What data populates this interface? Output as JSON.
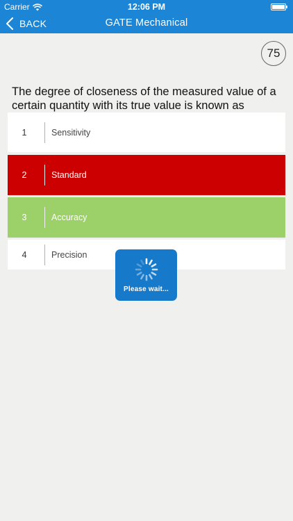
{
  "status_bar": {
    "carrier": "Carrier",
    "time": "12:06 PM",
    "wifi_icon": "wifi-icon",
    "battery_icon": "battery-icon"
  },
  "nav": {
    "back_label": "BACK",
    "back_icon": "chevron-left-icon",
    "title": "GATE Mechanical",
    "background_color": "#1d85d5"
  },
  "question": {
    "number": "75",
    "text": "The degree of closeness of the measured value of a certain quantity with its true value is known as"
  },
  "options": [
    {
      "number": "1",
      "label": "Sensitivity",
      "state": "default",
      "color": "#ffffff"
    },
    {
      "number": "2",
      "label": "Standard",
      "state": "wrong",
      "color": "#cc0000"
    },
    {
      "number": "3",
      "label": "Accuracy",
      "state": "correct",
      "color": "#9cd069"
    },
    {
      "number": "4",
      "label": "Precision",
      "state": "default",
      "color": "#ffffff"
    }
  ],
  "loading": {
    "text": "Please wait...",
    "icon": "spinner-icon",
    "color": "#1779c9"
  }
}
